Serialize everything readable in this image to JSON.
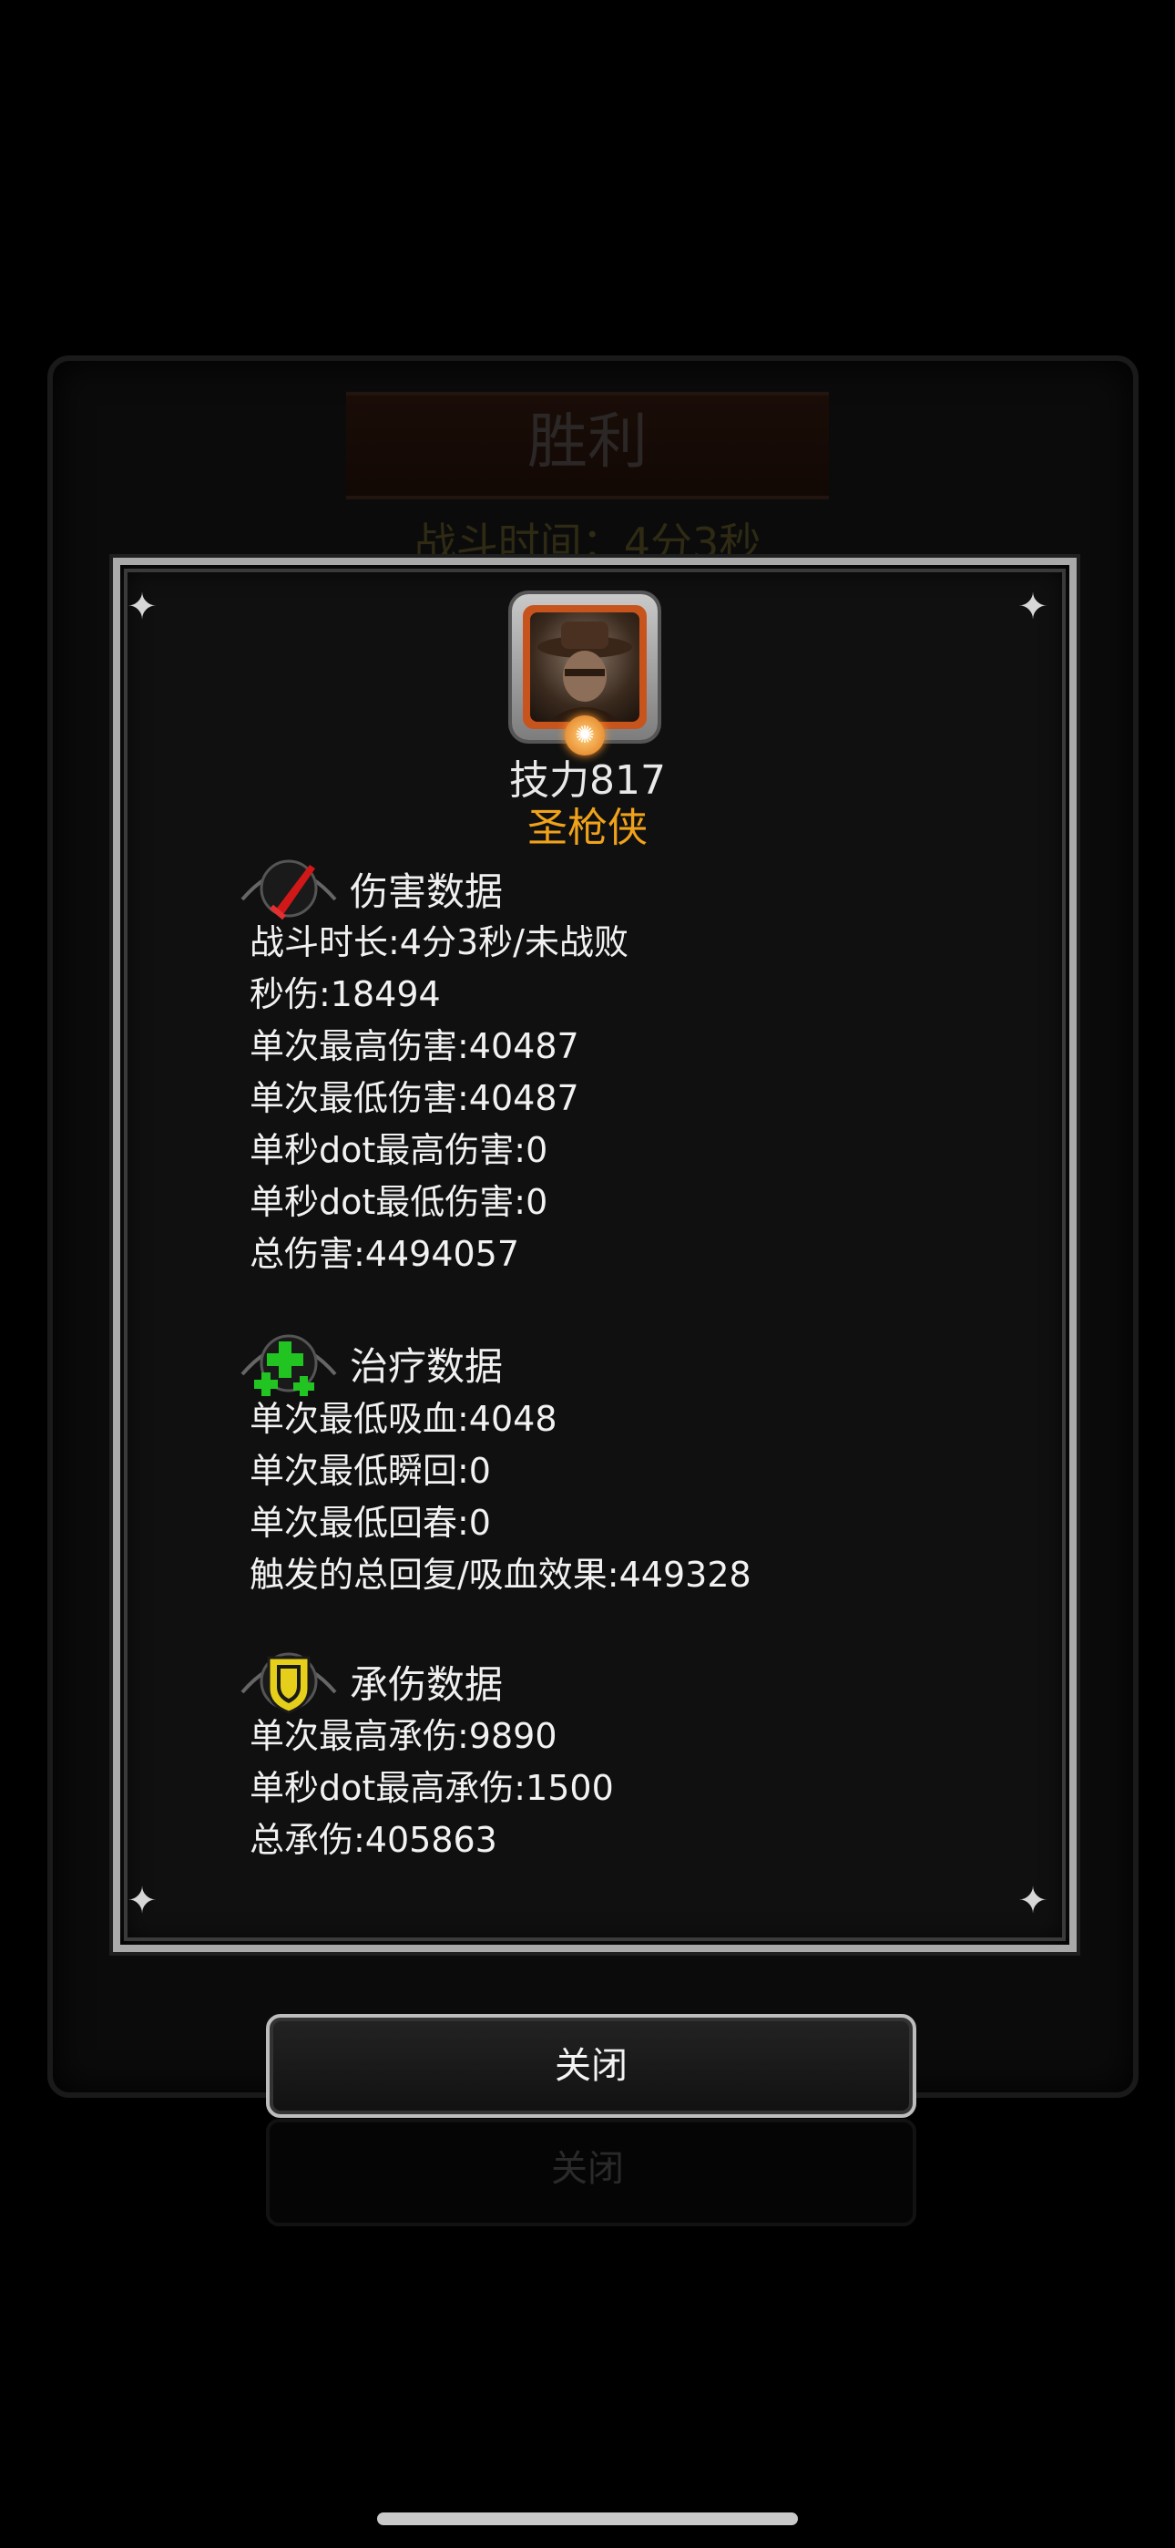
{
  "background": {
    "title": "胜利",
    "battle_time": "战斗时间：4分3秒",
    "button_label": "关闭"
  },
  "hero": {
    "power": "技力817",
    "name": "圣枪侠"
  },
  "damage": {
    "title": "伤害数据",
    "stats": [
      "战斗时长:4分3秒/未战败",
      "秒伤:18494",
      "单次最高伤害:40487",
      "单次最低伤害:40487",
      "单秒dot最高伤害:0",
      "单秒dot最低伤害:0",
      "总伤害:4494057"
    ]
  },
  "healing": {
    "title": "治疗数据",
    "stats": [
      "单次最低吸血:4048",
      "单次最低瞬回:0",
      "单次最低回春:0",
      "触发的总回复/吸血效果:449328"
    ]
  },
  "tank": {
    "title": "承伤数据",
    "stats": [
      "单次最高承伤:9890",
      "单秒dot最高承伤:1500",
      "总承伤:405863"
    ]
  },
  "close_button": "关闭",
  "colors": {
    "hero_name": "#f0a21b",
    "damage_icon": "#d01818",
    "healing_icon": "#22c422",
    "tank_icon": "#e6cf1a"
  },
  "icons": {
    "damage": "sword-icon",
    "healing": "green-cross-icon",
    "tank": "shield-icon"
  }
}
